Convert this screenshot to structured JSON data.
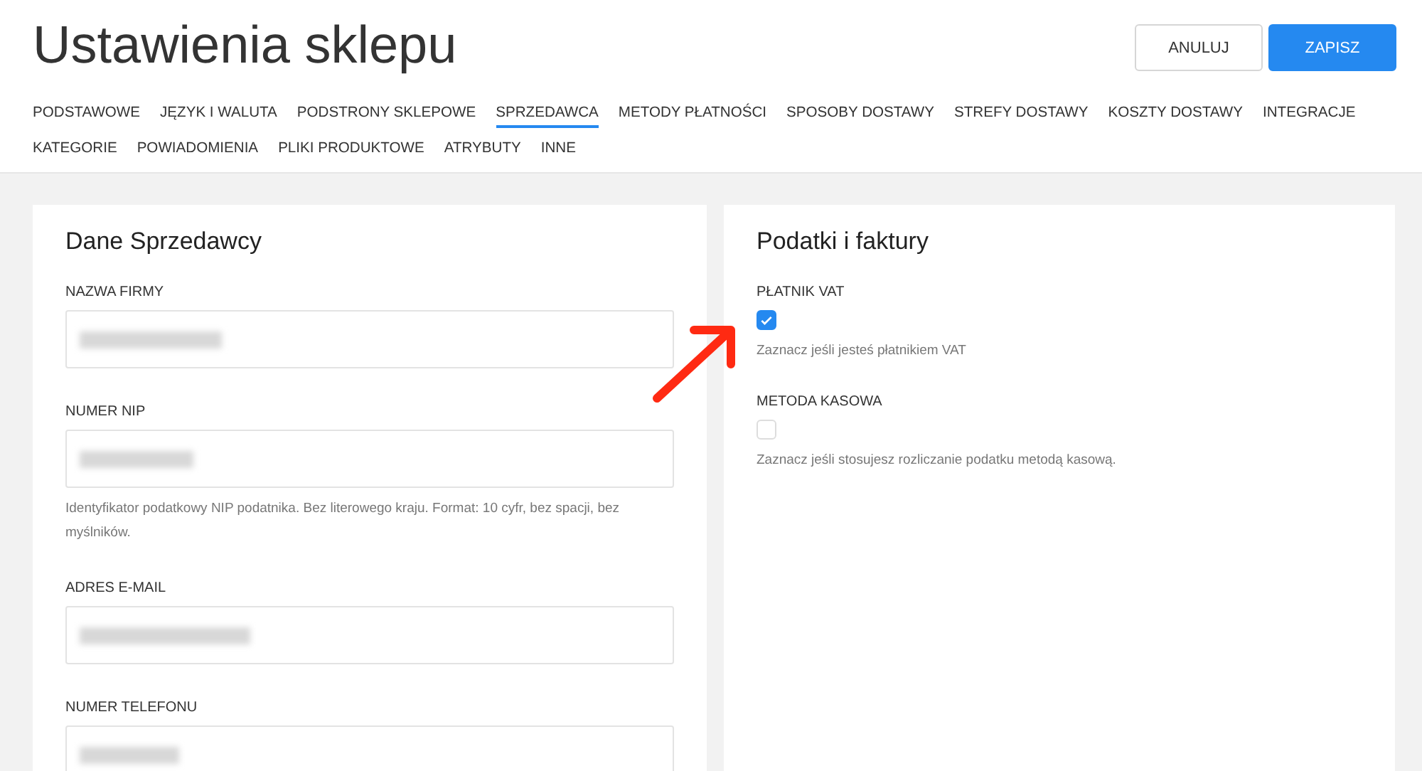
{
  "page": {
    "title": "Ustawienia sklepu"
  },
  "buttons": [
    {
      "label": "ANULUJ",
      "kind": "secondary"
    },
    {
      "label": "ZAPISZ",
      "kind": "primary"
    }
  ],
  "tabs": [
    {
      "label": "PODSTAWOWE",
      "selected": false
    },
    {
      "label": "JĘZYK I WALUTA",
      "selected": false
    },
    {
      "label": "PODSTRONY SKLEPOWE",
      "selected": false
    },
    {
      "label": "SPRZEDAWCA",
      "selected": true
    },
    {
      "label": "METODY PŁATNOŚCI",
      "selected": false
    },
    {
      "label": "SPOSOBY DOSTAWY",
      "selected": false
    },
    {
      "label": "STREFY DOSTAWY",
      "selected": false
    },
    {
      "label": "KOSZTY DOSTAWY",
      "selected": false
    },
    {
      "label": "INTEGRACJE",
      "selected": false
    },
    {
      "label": "KATEGORIE",
      "selected": false
    },
    {
      "label": "POWIADOMIENIA",
      "selected": false
    },
    {
      "label": "PLIKI PRODUKTOWE",
      "selected": false
    },
    {
      "label": "ATRYBUTY",
      "selected": false
    },
    {
      "label": "INNE",
      "selected": false
    }
  ],
  "seller_card": {
    "title": "Dane Sprzedawcy",
    "fields": [
      {
        "label": "NAZWA FIRMY",
        "blurred": true
      },
      {
        "label": "NUMER NIP",
        "blurred": true,
        "help": "Identyfikator podatkowy NIP podatnika. Bez literowego kraju. Format: 10 cyfr, bez spacji, bez myślników."
      },
      {
        "label": "ADRES E-MAIL",
        "blurred": true
      },
      {
        "label": "NUMER TELEFONU",
        "blurred": true
      }
    ]
  },
  "tax_card": {
    "title": "Podatki i faktury",
    "options": [
      {
        "label": "PŁATNIK VAT",
        "checked": true,
        "help": "Zaznacz jeśli jesteś płatnikiem VAT"
      },
      {
        "label": "METODA KASOWA",
        "checked": false,
        "help": "Zaznacz jeśli stosujesz rozliczanie podatku metodą kasową."
      }
    ]
  },
  "annotation": {
    "kind": "arrow"
  }
}
